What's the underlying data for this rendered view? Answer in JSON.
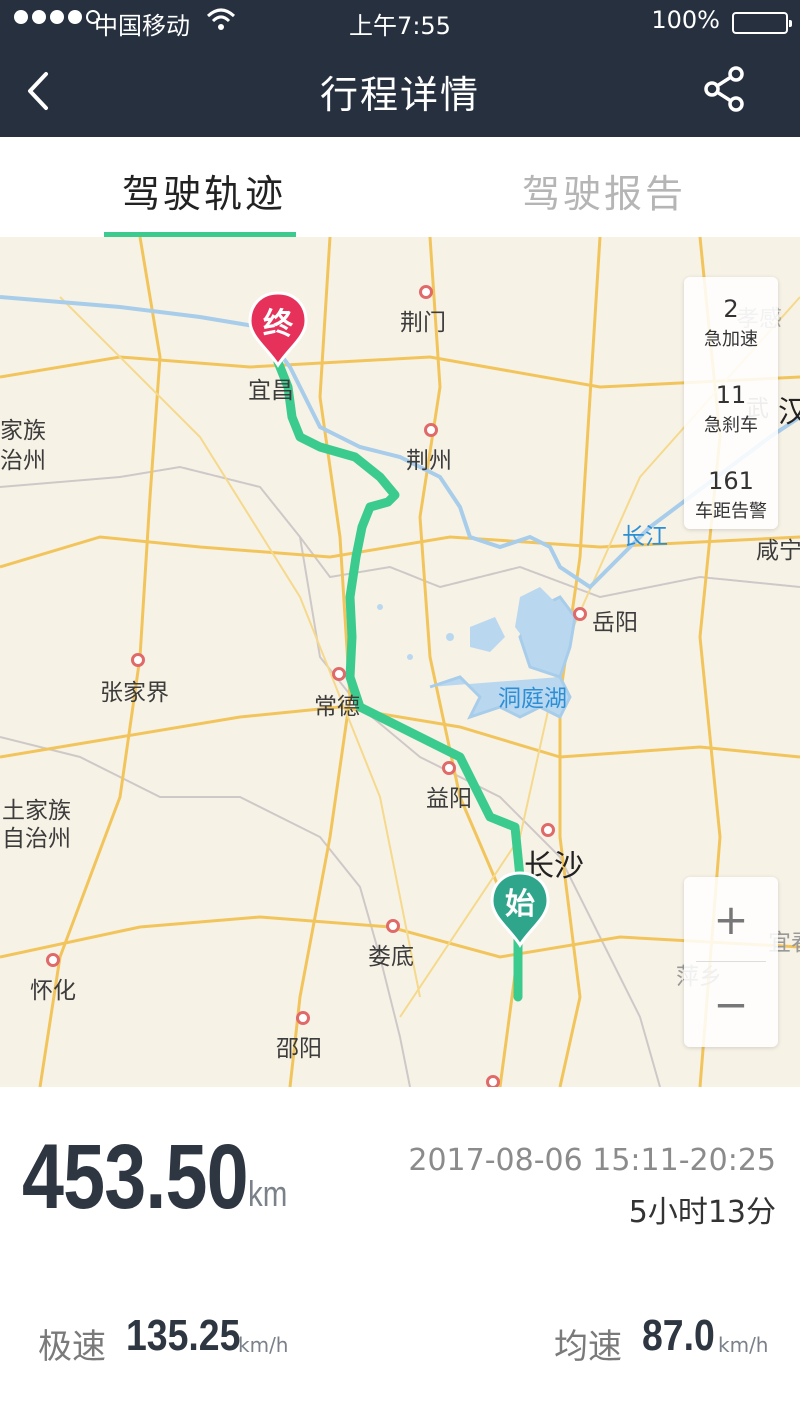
{
  "status_bar": {
    "carrier": "中国移动",
    "time": "上午7:55",
    "battery": "100%"
  },
  "nav": {
    "title": "行程详情",
    "back_icon": "chevron-left-icon",
    "share_icon": "share-icon"
  },
  "tabs": [
    {
      "label": "驾驶轨迹",
      "active": true
    },
    {
      "label": "驾驶报告",
      "active": false
    }
  ],
  "map": {
    "start_marker": "始",
    "end_marker": "终",
    "route_color": "#3ccb8e",
    "events": [
      {
        "count": "2",
        "label": "急加速"
      },
      {
        "count": "11",
        "label": "急刹车"
      },
      {
        "count": "161",
        "label": "车距告警"
      }
    ],
    "zoom_in": "+",
    "zoom_out": "−",
    "places": {
      "jingmen": "荆门",
      "yichang": "宜昌",
      "jingzhou": "荆州",
      "changjiang": "长江",
      "yueyang": "岳阳",
      "dongtinghu": "洞庭湖",
      "zhangjiajie": "张家界",
      "changde": "常德",
      "yiyang": "益阳",
      "changsha": "长沙",
      "loudi": "娄底",
      "huaihua": "怀化",
      "shaoyang": "邵阳",
      "xianning": "咸宁",
      "wuhan_partial": "汉",
      "wu_partial": "武",
      "xiaogan_partial": "孝感",
      "tujia1": "家族",
      "tujia2": "治州",
      "tujia3": "土家族",
      "tujia4": "自治州",
      "pingxiang": "萍乡",
      "yichun_partial": "宜春"
    }
  },
  "trip": {
    "distance": "453.50",
    "distance_unit": "km",
    "datetime": "2017-08-06 15:11-20:25",
    "duration": "5小时13分",
    "max_speed_label": "极速",
    "max_speed": "135.25",
    "avg_speed_label": "均速",
    "avg_speed": "87.0",
    "speed_unit": "km/h"
  }
}
